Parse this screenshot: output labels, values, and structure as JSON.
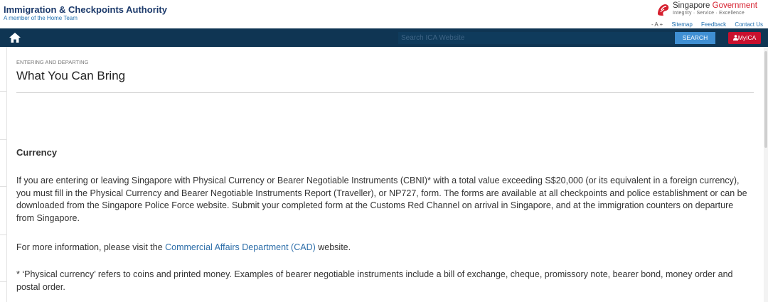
{
  "header": {
    "agency_name": "Immigration & Checkpoints Authority",
    "agency_subtitle": "A member of the Home Team",
    "gov_name_prefix": "Singapore ",
    "gov_name_suffix": "Government",
    "gov_tagline": "Integrity · Service · Excellence",
    "font_size_controls": "- A +",
    "links": [
      "Sitemap",
      "Feedback",
      "Contact Us"
    ]
  },
  "nav": {
    "search_placeholder": "Search ICA Website",
    "search_button": "SEARCH",
    "myica_label": "MyICA"
  },
  "page": {
    "section": "ENTERING AND DEPARTING",
    "title": "What You Can Bring"
  },
  "currency": {
    "heading": "Currency",
    "paragraph1": "If you are entering or leaving Singapore with Physical Currency or Bearer Negotiable Instruments (CBNI)* with a total value exceeding S$20,000 (or its equivalent in a foreign currency), you must fill in the Physical Currency and Bearer Negotiable Instruments Report (Traveller), or NP727, form. The forms are available at all checkpoints and police establishment or can be downloaded from the Singapore Police Force website. Submit your completed form at the Customs Red Channel on arrival in Singapore, and at the immigration counters on departure from Singapore.",
    "info_prefix": "For more information, please visit the ",
    "info_link": "Commercial Affairs Department (CAD)",
    "info_suffix": " website.",
    "footnote": "* ‘Physical currency’ refers to coins and printed money. Examples of bearer negotiable instruments include a bill of exchange, cheque, promissory note, bearer bond, money order and postal order."
  },
  "colors": {
    "navbar": "#0f3553",
    "search_button": "#3f8fd3",
    "myica_button": "#c8102e",
    "brand_title": "#1c3a6b",
    "link": "#2d6ea9",
    "gov_red": "#d6202f"
  },
  "icons": {
    "home": "home-icon",
    "lion": "singapore-lion-icon",
    "person": "person-icon"
  }
}
